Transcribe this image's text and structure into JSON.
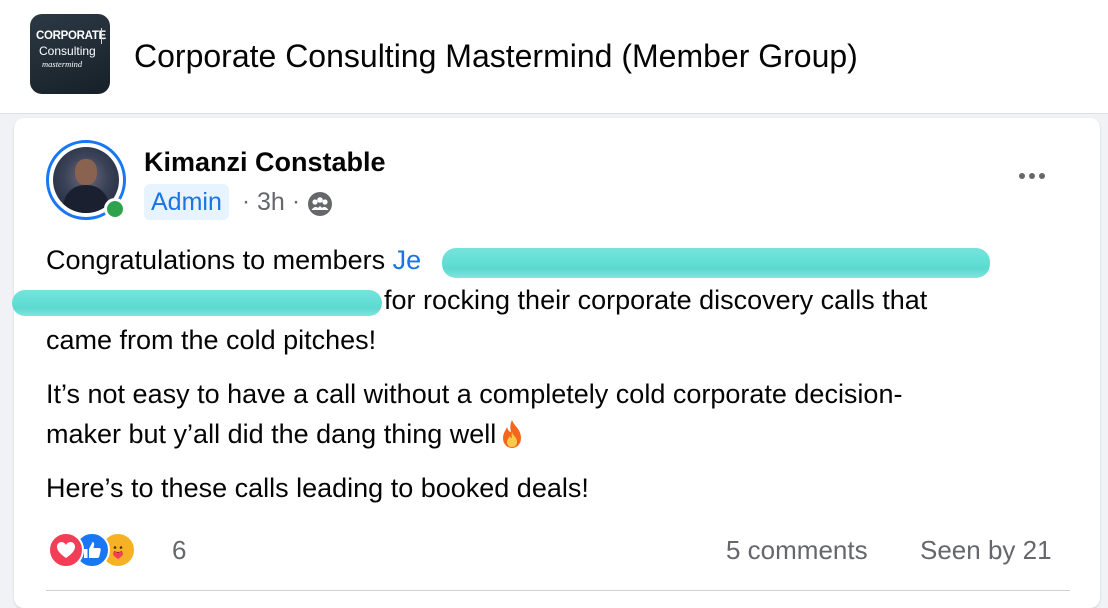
{
  "group": {
    "title": "Corporate Consulting Mastermind (Member Group)",
    "logo": {
      "line1": "CORPORATE",
      "line2": "Consulting",
      "line3": "mastermind"
    }
  },
  "post": {
    "author": "Kimanzi Constable",
    "badge": "Admin",
    "separator": "·",
    "time": "3h",
    "privacy_icon": "group-members-icon",
    "more_icon": "more-horizontal-icon",
    "paragraphs": {
      "p1_start": "Congratulations to members ",
      "p1_mention_visible": "Je",
      "p1_line2": "for rocking their corporate discovery calls that",
      "p1_line3": "came from the cold pitches!",
      "p2_line1": "It’s not easy to have a call without a completely cold corporate decision-",
      "p2_line2": "maker but y’all did the dang thing well",
      "p3": "Here’s to these calls leading to booked deals!"
    },
    "emoji": "fire-icon",
    "reactions": {
      "icons": [
        "love-reaction-icon",
        "like-reaction-icon",
        "care-reaction-icon"
      ],
      "count": "6"
    },
    "comments": "5 comments",
    "seen": "Seen by 21"
  },
  "colors": {
    "link_blue": "#1b74e4",
    "badge_bg": "#e7f3ff",
    "online_green": "#31a24c",
    "redaction_cyan": "#5cd9cf",
    "muted_text": "#65676b"
  }
}
